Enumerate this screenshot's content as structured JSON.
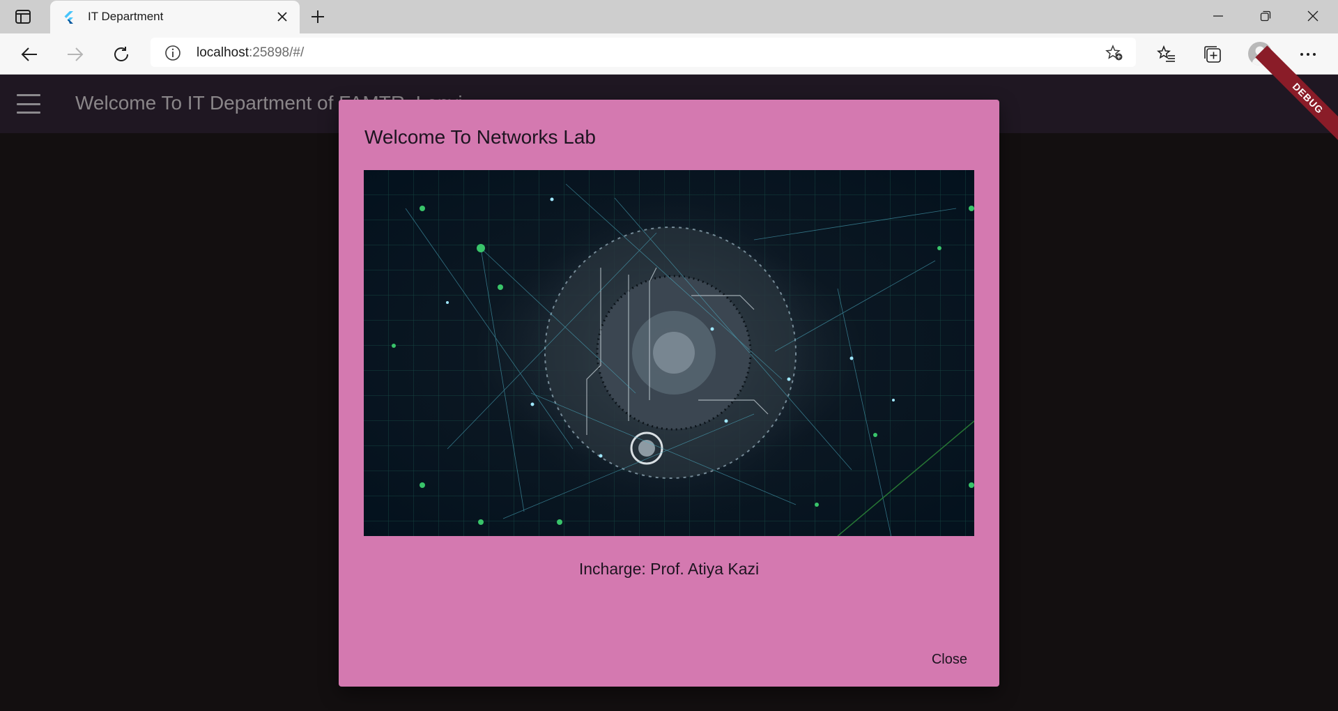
{
  "browser": {
    "tab_title": "IT Department",
    "address": {
      "host": "localhost",
      "rest": ":25898/#/"
    }
  },
  "app": {
    "appbar_title": "Welcome To IT Department of FAMTR, Lonvi...",
    "debug_label": "DEBUG"
  },
  "dialog": {
    "title": "Welcome To Networks Lab",
    "image_icon": "network-globe-image",
    "caption": "Incharge: Prof. Atiya Kazi",
    "close_label": "Close"
  },
  "colors": {
    "dialog_bg": "#d479b0",
    "appbar_bg": "#1f1722",
    "page_bg": "#130f10",
    "debug_banner": "#8a1c28"
  }
}
